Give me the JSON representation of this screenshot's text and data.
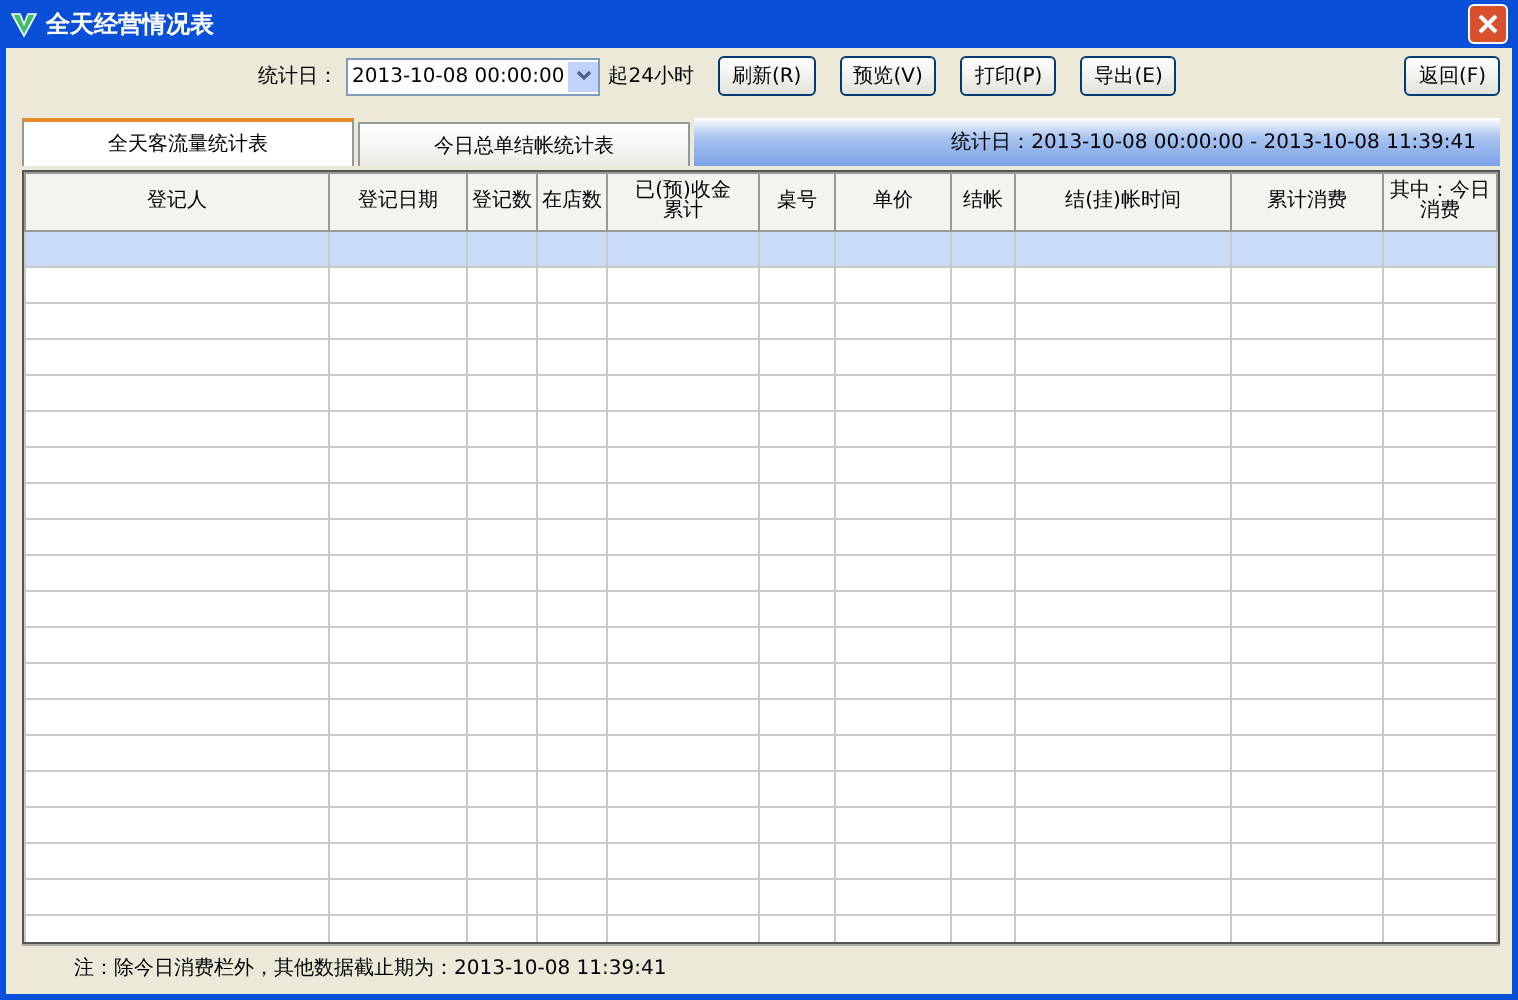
{
  "window": {
    "title": "全天经营情况表"
  },
  "toolbar": {
    "date_label": "统计日：",
    "date_value": "2013-10-08 00:00:00",
    "range_label": "起24小时",
    "buttons": [
      "刷新(R)",
      "预览(V)",
      "打印(P)",
      "导出(E)"
    ],
    "return_button": "返回(F)"
  },
  "tabs": [
    {
      "label": "全天客流量统计表",
      "selected": true
    },
    {
      "label": "今日总单结帐统计表",
      "selected": false
    }
  ],
  "period": "统计日：2013-10-08 00:00:00 - 2013-10-08 11:39:41",
  "table": {
    "columns": [
      "登记人",
      "登记日期",
      "登记数",
      "在店数",
      "已(预)收金累计",
      "桌号",
      "单价",
      "结帐",
      "结(挂)帐时间",
      "累计消费",
      "其中：今日消费"
    ],
    "rows": [
      {
        "selected": true
      },
      {
        "selected": false
      },
      {
        "selected": false
      },
      {
        "selected": false
      },
      {
        "selected": false
      },
      {
        "selected": false
      },
      {
        "selected": false
      },
      {
        "selected": false
      },
      {
        "selected": false
      },
      {
        "selected": false
      },
      {
        "selected": false
      },
      {
        "selected": false
      },
      {
        "selected": false
      },
      {
        "selected": false
      },
      {
        "selected": false
      },
      {
        "selected": false
      },
      {
        "selected": false
      },
      {
        "selected": false
      },
      {
        "selected": false
      },
      {
        "selected": false
      }
    ]
  },
  "status_bar": "注：除今日消费栏外，其他数据截止期为：2013-10-08 11:39:41"
}
